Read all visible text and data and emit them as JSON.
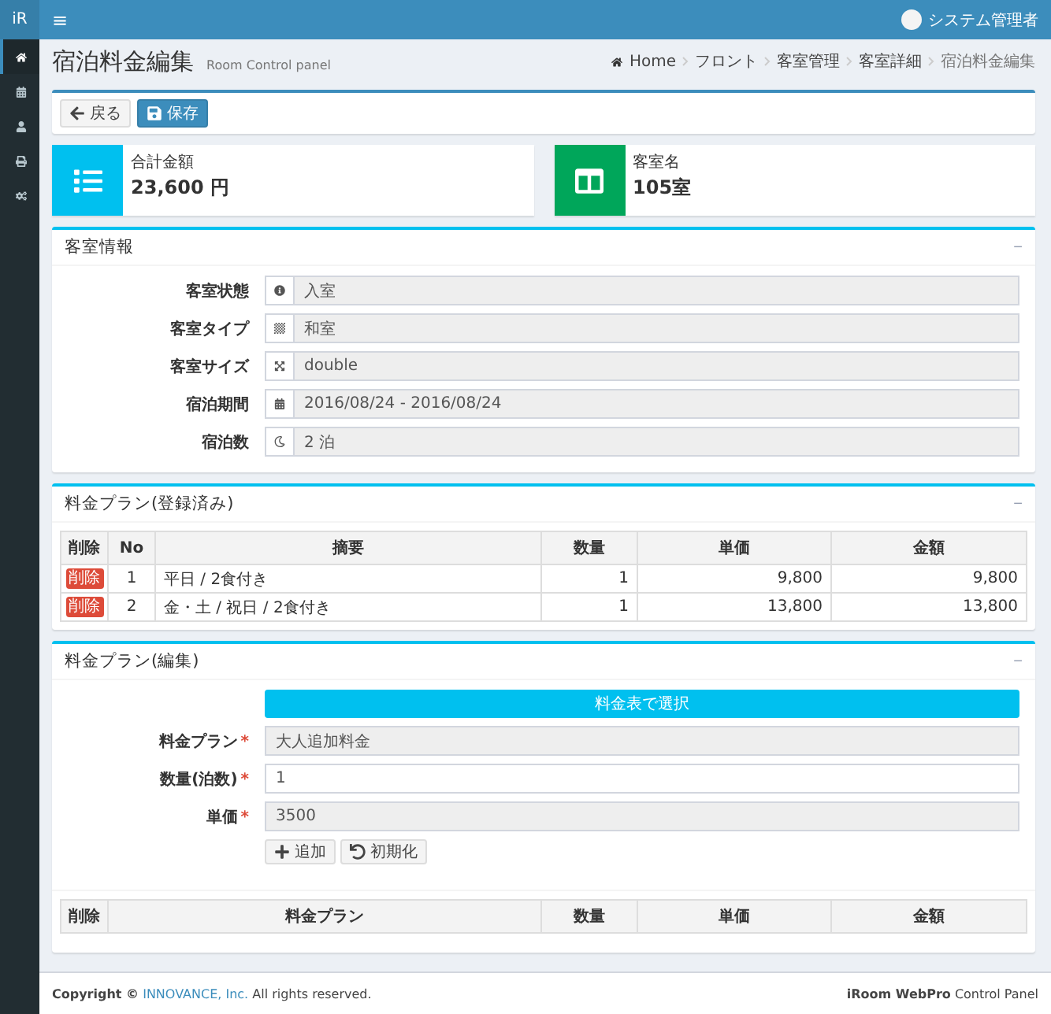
{
  "topbar": {
    "logo": "iR",
    "menu_glyph": "≡",
    "user": "システム管理者"
  },
  "sidebar": {
    "items": [
      {
        "kind": "home",
        "selected": true
      },
      {
        "kind": "calendar",
        "selected": false
      },
      {
        "kind": "user",
        "selected": false
      },
      {
        "kind": "print",
        "selected": false
      },
      {
        "kind": "settings",
        "selected": false
      }
    ]
  },
  "header": {
    "title": "宿泊料金編集",
    "subtitle": "Room Control panel",
    "breadcrumb": [
      "Home",
      "フロント",
      "客室管理",
      "客室詳細",
      "宿泊料金編集"
    ]
  },
  "actions": [
    {
      "kind": "back",
      "label": "戻る",
      "primary": false
    },
    {
      "kind": "save",
      "label": "保存",
      "primary": true
    }
  ],
  "info_boxes": [
    {
      "kind": "list",
      "color": "#00c0ef",
      "label": "合計金額",
      "value": "23,600 円"
    },
    {
      "kind": "columns",
      "color": "#00a65a",
      "label": "客室名",
      "value": "105室"
    }
  ],
  "room_info": {
    "title": "客室情報",
    "collapse_glyph": "−",
    "fields": [
      {
        "kind": "status",
        "label": "客室状態",
        "value": "入室"
      },
      {
        "kind": "type",
        "label": "客室タイプ",
        "value": "和室"
      },
      {
        "kind": "size",
        "label": "客室サイズ",
        "value": "double"
      },
      {
        "kind": "period",
        "label": "宿泊期間",
        "value": "2016/08/24 - 2016/08/24"
      },
      {
        "kind": "nights",
        "label": "宿泊数",
        "value": "2 泊"
      }
    ]
  },
  "registered_plans": {
    "title": "料金プラン(登録済み)",
    "collapse_glyph": "−",
    "table": {
      "columns": [
        "削除",
        "No",
        "摘要",
        "数量",
        "単価",
        "金額"
      ],
      "rows": [
        {
          "cells": [
            "削除",
            "1",
            "平日 / 2食付き",
            "1",
            "9,800",
            "9,800"
          ]
        },
        {
          "cells": [
            "削除",
            "2",
            "金・土 / 祝日 / 2食付き",
            "1",
            "13,800",
            "13,800"
          ]
        }
      ]
    }
  },
  "edit_plan": {
    "title": "料金プラン(編集)",
    "collapse_glyph": "−",
    "select_button": "料金表で選択",
    "fields": [
      {
        "label": "料金プラン",
        "required_mark": "*",
        "disabled": true,
        "value": "大人追加料金"
      },
      {
        "label": "数量(泊数)",
        "required_mark": "*",
        "disabled": false,
        "value": "1"
      },
      {
        "label": "単価",
        "required_mark": "*",
        "disabled": true,
        "value": "3500"
      }
    ],
    "buttons": [
      {
        "kind": "add",
        "label": "追加"
      },
      {
        "kind": "reset",
        "label": "初期化"
      }
    ],
    "table": {
      "columns": [
        "削除",
        "料金プラン",
        "数量",
        "単価",
        "金額"
      ]
    }
  },
  "footer": {
    "copyright": "**Copyright ©**",
    "company": "INNOVANCE, Inc.",
    "rights": "All rights reserved.",
    "product": "**iRoom WebPro** Control Panel"
  }
}
